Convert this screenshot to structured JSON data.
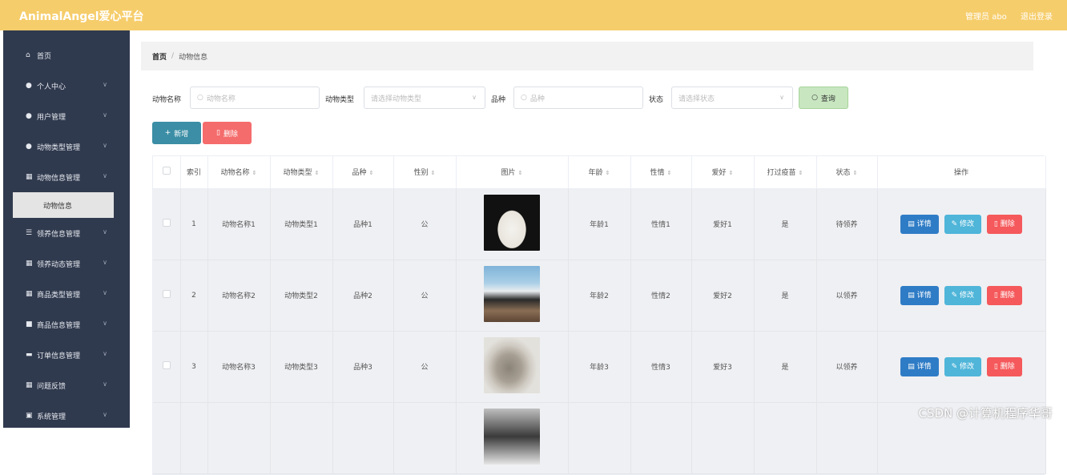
{
  "app": {
    "title": "AnimalAngel爱心平台",
    "admin": "管理员 abo",
    "logout": "退出登录"
  },
  "sidebar": {
    "items": [
      {
        "label": "首页",
        "icon": "home-icon"
      },
      {
        "label": "个人中心",
        "icon": "person-icon"
      },
      {
        "label": "用户管理",
        "icon": "user-icon"
      },
      {
        "label": "动物类型管理",
        "icon": "paw-icon"
      },
      {
        "label": "动物信息管理",
        "icon": "grid-icon"
      },
      {
        "label": "领养信息管理",
        "icon": "list-icon"
      },
      {
        "label": "领养动态管理",
        "icon": "grid-icon"
      },
      {
        "label": "商品类型管理",
        "icon": "grid-icon"
      },
      {
        "label": "商品信息管理",
        "icon": "box-icon"
      },
      {
        "label": "订单信息管理",
        "icon": "order-icon"
      },
      {
        "label": "问题反馈",
        "icon": "grid-icon"
      },
      {
        "label": "系统管理",
        "icon": "settings-icon"
      }
    ],
    "active_sub": "动物信息"
  },
  "breadcrumb": {
    "home": "首页",
    "sep": "/",
    "current": "动物信息"
  },
  "filters": {
    "name_label": "动物名称",
    "name_placeholder": "动物名称",
    "type_label": "动物类型",
    "type_placeholder": "请选择动物类型",
    "breed_label": "品种",
    "breed_placeholder": "品种",
    "status_label": "状态",
    "status_placeholder": "请选择状态",
    "search_button": "查询"
  },
  "actions": {
    "add": "新增",
    "delete": "删除"
  },
  "table": {
    "headers": [
      "索引",
      "动物名称",
      "动物类型",
      "品种",
      "性别",
      "图片",
      "年龄",
      "性情",
      "爱好",
      "打过疫苗",
      "状态",
      "操作"
    ],
    "rows": [
      {
        "index": "1",
        "name": "动物名称1",
        "type": "动物类型1",
        "breed": "品种1",
        "sex": "公",
        "age": "年龄1",
        "temper": "性情1",
        "hobby": "爱好1",
        "vaccinated": "是",
        "status": "待领养"
      },
      {
        "index": "2",
        "name": "动物名称2",
        "type": "动物类型2",
        "breed": "品种2",
        "sex": "公",
        "age": "年龄2",
        "temper": "性情2",
        "hobby": "爱好2",
        "vaccinated": "是",
        "status": "以领养"
      },
      {
        "index": "3",
        "name": "动物名称3",
        "type": "动物类型3",
        "breed": "品种3",
        "sex": "公",
        "age": "年龄3",
        "temper": "性情3",
        "hobby": "爱好3",
        "vaccinated": "是",
        "status": "以领养"
      }
    ],
    "row_actions": {
      "detail": "详情",
      "edit": "修改",
      "delete": "删除"
    }
  },
  "watermark": "CSDN @计算机程序华哥",
  "colors": {
    "topbar": "#f6cd6b",
    "sidebar": "#303a4e",
    "primary": "#2f7cc6",
    "info": "#4fb5d9",
    "danger": "#f56c6c",
    "success": "#c8e6c0",
    "add": "#3b8ea5"
  }
}
